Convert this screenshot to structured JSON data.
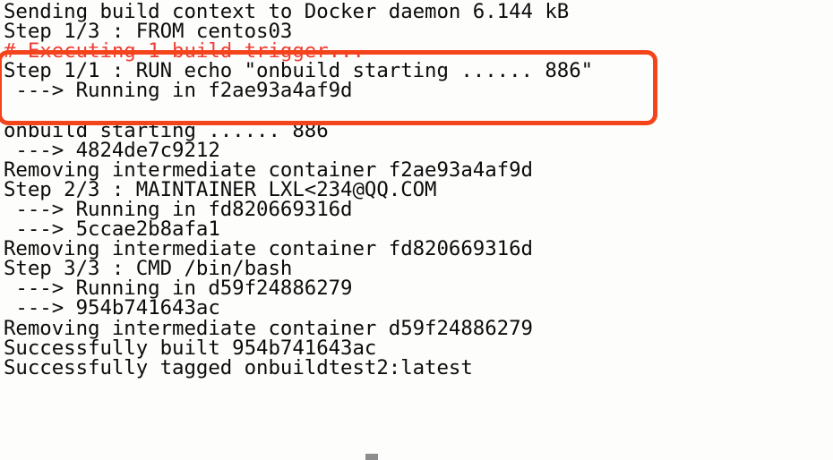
{
  "terminal": {
    "background_color": "#fdfdfc",
    "text_color": "#0c0c0c",
    "highlight_text_color": "#ee4036",
    "annotation_border_color": "#f4441c",
    "cursor_color": "#8d8d8d",
    "font_size_px": 22,
    "line_height_px": 22,
    "lines": [
      {
        "text": "Sending build context to Docker daemon 6.144 kB",
        "style": "normal"
      },
      {
        "text": "Step 1/3 : FROM centos03",
        "style": "normal"
      },
      {
        "text": "# Executing 1 build trigger...",
        "style": "red"
      },
      {
        "text": "Step 1/1 : RUN echo \"onbuild starting ...... 886\"",
        "style": "normal"
      },
      {
        "text": " ---> Running in f2ae93a4af9d",
        "style": "normal"
      },
      {
        "text": "",
        "style": "blank"
      },
      {
        "text": "onbuild starting ...... 886",
        "style": "normal"
      },
      {
        "text": " ---> 4824de7c9212",
        "style": "normal"
      },
      {
        "text": "Removing intermediate container f2ae93a4af9d",
        "style": "normal"
      },
      {
        "text": "Step 2/3 : MAINTAINER LXL<234@QQ.COM",
        "style": "normal"
      },
      {
        "text": " ---> Running in fd820669316d",
        "style": "normal"
      },
      {
        "text": " ---> 5ccae2b8afa1",
        "style": "normal"
      },
      {
        "text": "Removing intermediate container fd820669316d",
        "style": "normal"
      },
      {
        "text": "Step 3/3 : CMD /bin/bash",
        "style": "normal"
      },
      {
        "text": " ---> Running in d59f24886279",
        "style": "normal"
      },
      {
        "text": " ---> 954b741643ac",
        "style": "normal"
      },
      {
        "text": "Removing intermediate container d59f24886279",
        "style": "normal"
      },
      {
        "text": "Successfully built 954b741643ac",
        "style": "normal"
      },
      {
        "text": "Successfully tagged onbuildtest2:latest",
        "style": "normal"
      }
    ]
  },
  "annotation": {
    "label": "build-trigger-highlight"
  }
}
